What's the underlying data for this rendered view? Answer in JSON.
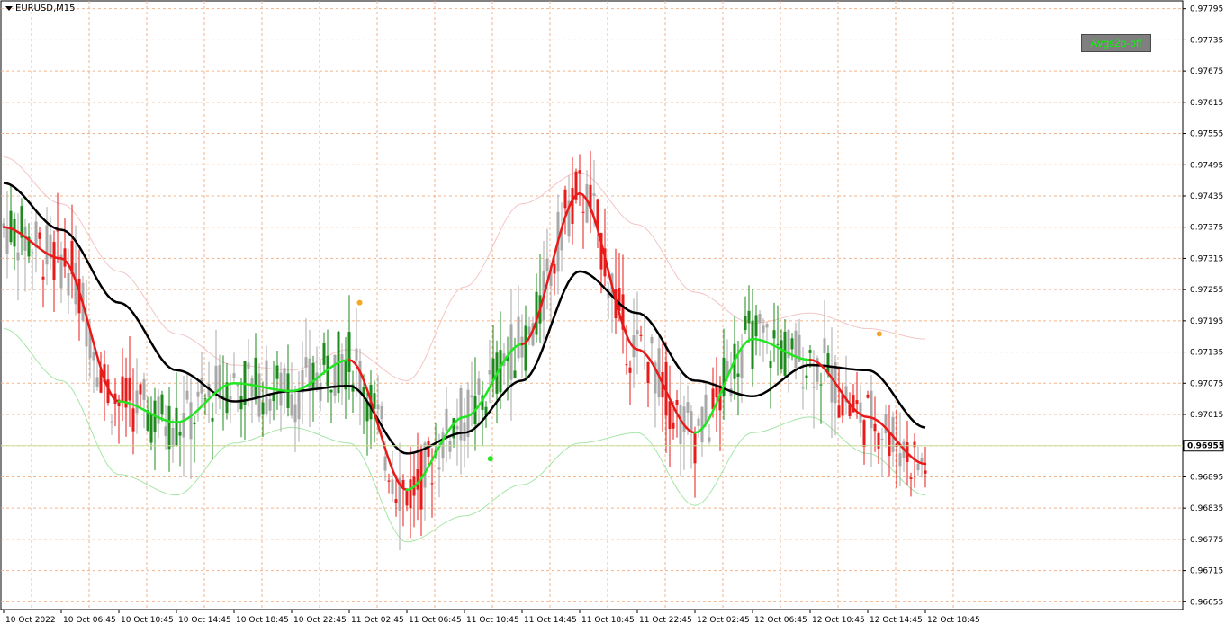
{
  "symbol": "EURUSD,M15",
  "button_label": "Avgs2b-off",
  "current_price": "0.96955",
  "y_ticks": [
    "0.97795",
    "0.97735",
    "0.97675",
    "0.97615",
    "0.97555",
    "0.97495",
    "0.97435",
    "0.97375",
    "0.97315",
    "0.97255",
    "0.97195",
    "0.97135",
    "0.97075",
    "0.97015",
    "0.96955",
    "0.96895",
    "0.96835",
    "0.96775",
    "0.96715",
    "0.96655"
  ],
  "x_ticks": [
    "10 Oct 2022",
    "10 Oct 06:45",
    "10 Oct 10:45",
    "10 Oct 14:45",
    "10 Oct 18:45",
    "10 Oct 22:45",
    "11 Oct 02:45",
    "11 Oct 06:45",
    "11 Oct 10:45",
    "11 Oct 14:45",
    "11 Oct 18:45",
    "11 Oct 22:45",
    "12 Oct 02:45",
    "12 Oct 06:45",
    "12 Oct 10:45",
    "12 Oct 14:45",
    "12 Oct 18:45"
  ],
  "colors": {
    "grid": "#f2b48a",
    "candle_neutral": "#a8a8a8",
    "candle_bull": "#1e8a1e",
    "candle_bear": "#e81a1a",
    "ma_up": "#22e622",
    "ma_down": "#e81a1a",
    "slow_ma": "#000000",
    "band_upper": "#f3c4c4",
    "band_lower": "#a5e6a5",
    "price_line": "#c8e0a0"
  },
  "chart_data": {
    "type": "line",
    "title": "EURUSD,M15",
    "xlabel": "",
    "ylabel": "",
    "ylim": [
      0.9664,
      0.9781
    ],
    "x": [
      "10 Oct 2022",
      "10 Oct 06:45",
      "10 Oct 10:45",
      "10 Oct 14:45",
      "10 Oct 18:45",
      "10 Oct 22:45",
      "11 Oct 02:45",
      "11 Oct 06:45",
      "11 Oct 10:45",
      "11 Oct 14:45",
      "11 Oct 18:45",
      "11 Oct 22:45",
      "12 Oct 02:45",
      "12 Oct 06:45",
      "12 Oct 10:45",
      "12 Oct 14:45",
      "12 Oct 18:45"
    ],
    "series": [
      {
        "role": "fast",
        "values": [
          0.97375,
          0.97315,
          0.9704,
          0.97,
          0.97075,
          0.9706,
          0.9712,
          0.9687,
          0.9701,
          0.9715,
          0.9744,
          0.9714,
          0.9698,
          0.9716,
          0.9712,
          0.9701,
          0.9692
        ],
        "trend": [
          "up",
          "down",
          "down",
          "up",
          "up",
          "up",
          "up",
          "down",
          "up",
          "up",
          "down",
          "down",
          "down",
          "up",
          "up",
          "down",
          "down"
        ]
      },
      {
        "role": "slow",
        "values": [
          0.9746,
          0.9737,
          0.9723,
          0.971,
          0.9704,
          0.9706,
          0.9707,
          0.9694,
          0.9698,
          0.9708,
          0.9729,
          0.9721,
          0.9708,
          0.9705,
          0.9711,
          0.971,
          0.9699
        ]
      },
      {
        "role": "upper-band",
        "values": [
          0.9751,
          0.9742,
          0.9729,
          0.9717,
          0.9711,
          0.971,
          0.9714,
          0.9708,
          0.9726,
          0.9742,
          0.9748,
          0.9738,
          0.9725,
          0.9719,
          0.9721,
          0.9718,
          0.9716
        ]
      },
      {
        "role": "lower-band",
        "values": [
          0.9718,
          0.9708,
          0.969,
          0.9686,
          0.9696,
          0.9699,
          0.9696,
          0.9677,
          0.9682,
          0.9688,
          0.9696,
          0.9698,
          0.9684,
          0.9698,
          0.9701,
          0.9694,
          0.9686
        ]
      }
    ],
    "markers": [
      {
        "x": 6.18,
        "y": 0.9723,
        "color": "#f5a623"
      },
      {
        "x": 8.45,
        "y": 0.9693,
        "color": "#22e622"
      },
      {
        "x": 15.2,
        "y": 0.9717,
        "color": "#f5a623"
      }
    ]
  }
}
